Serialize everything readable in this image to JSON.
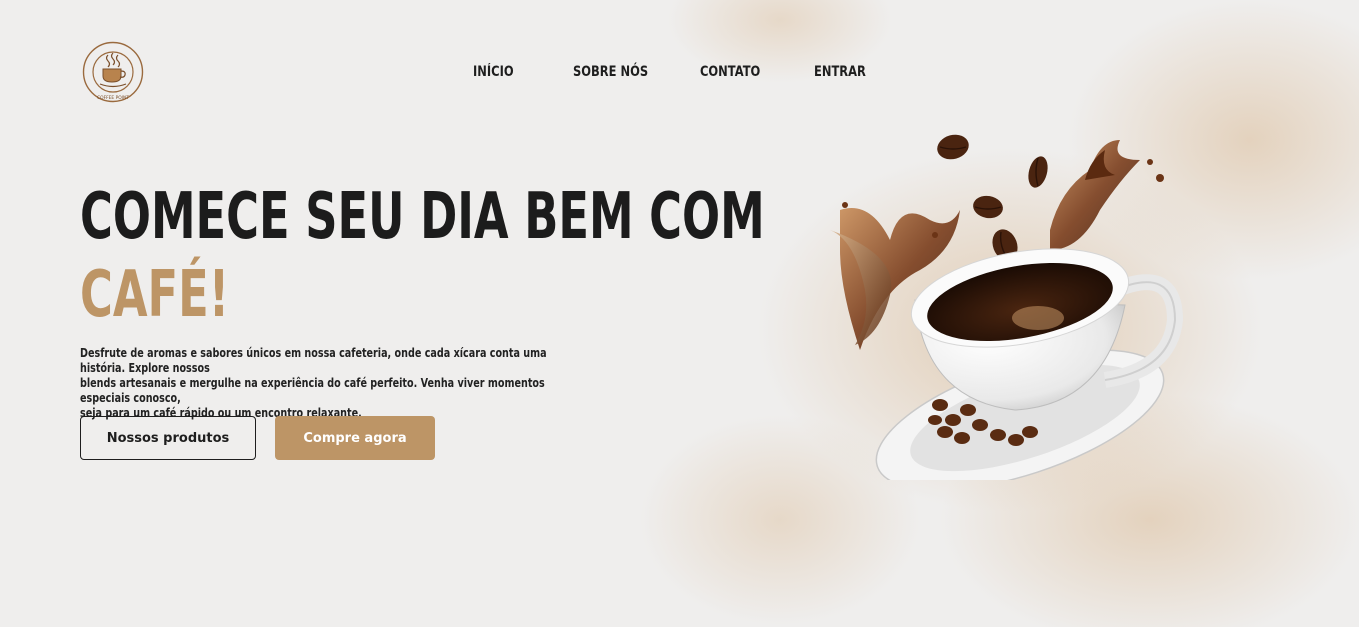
{
  "brand": {
    "logo_text": "COFFEE POINT"
  },
  "nav": {
    "items": [
      {
        "label": "INÍCIO"
      },
      {
        "label": "SOBRE NÓS"
      },
      {
        "label": "CONTATO"
      },
      {
        "label": "ENTRAR"
      }
    ]
  },
  "hero": {
    "title_line1": "COMECE SEU DIA BEM COM",
    "title_line2": "CAFÉ!",
    "description_lines": [
      "Desfrute de aromas e sabores únicos em nossa cafeteria, onde cada xícara conta uma história. Explore nossos",
      "blends artesanais e mergulhe na experiência do café perfeito. Venha viver momentos especiais conosco,",
      "seja para um café rápido ou um encontro relaxante."
    ],
    "primary_button": "Nossos produtos",
    "secondary_button": "Compre agora"
  },
  "colors": {
    "accent": "#bd9566",
    "text_dark": "#1c1c1c",
    "background": "#efeeed"
  },
  "illustration": {
    "icon": "coffee-cup-splash-illustration"
  }
}
